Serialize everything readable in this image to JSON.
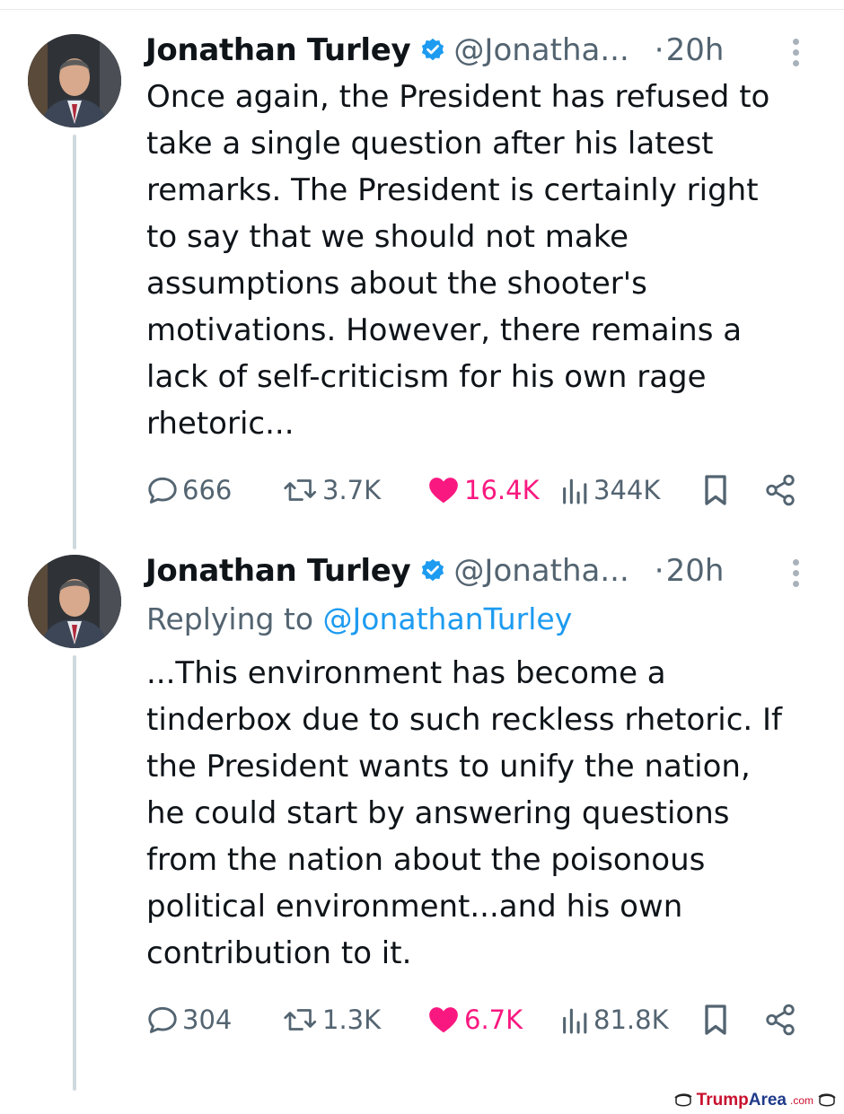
{
  "tweets": [
    {
      "author": {
        "name": "Jonathan Turley",
        "handle": "@Jonatha...",
        "verified": true,
        "avatar_icon": "profile-photo"
      },
      "separator": "·",
      "time": "20h",
      "replying_to": null,
      "lines": [
        "Once again, the President has refused to",
        "take a single question after his latest",
        "remarks. The President is certainly right",
        "to say that we should not make",
        "assumptions about the shooter's",
        "motivations. However, there remains a",
        "lack of self-criticism for his own rage",
        "rhetoric..."
      ],
      "stats": {
        "replies": "666",
        "reposts": "3.7K",
        "likes": "16.4K",
        "views": "344K"
      }
    },
    {
      "author": {
        "name": "Jonathan Turley",
        "handle": "@Jonatha...",
        "verified": true,
        "avatar_icon": "profile-photo"
      },
      "separator": "·",
      "time": "20h",
      "replying_to": {
        "prefix": "Replying to",
        "mention": "@JonathanTurley"
      },
      "lines": [
        "...This environment has become a",
        "tinderbox due to such reckless rhetoric. If",
        "the President wants to unify the nation,",
        "he could start by answering questions",
        "from the nation about the poisonous",
        "political environment...and his own",
        "contribution to it."
      ],
      "stats": {
        "replies": "304",
        "reposts": "1.3K",
        "likes": "6.7K",
        "views": "81.8K"
      }
    }
  ],
  "colors": {
    "text": "#0f1419",
    "muted": "#536471",
    "like": "#f91880",
    "link": "#1d9bf0",
    "verified": "#1d9bf0"
  },
  "watermark": {
    "brand_a": "Trump",
    "brand_b": "Area",
    "tld": ".com"
  }
}
